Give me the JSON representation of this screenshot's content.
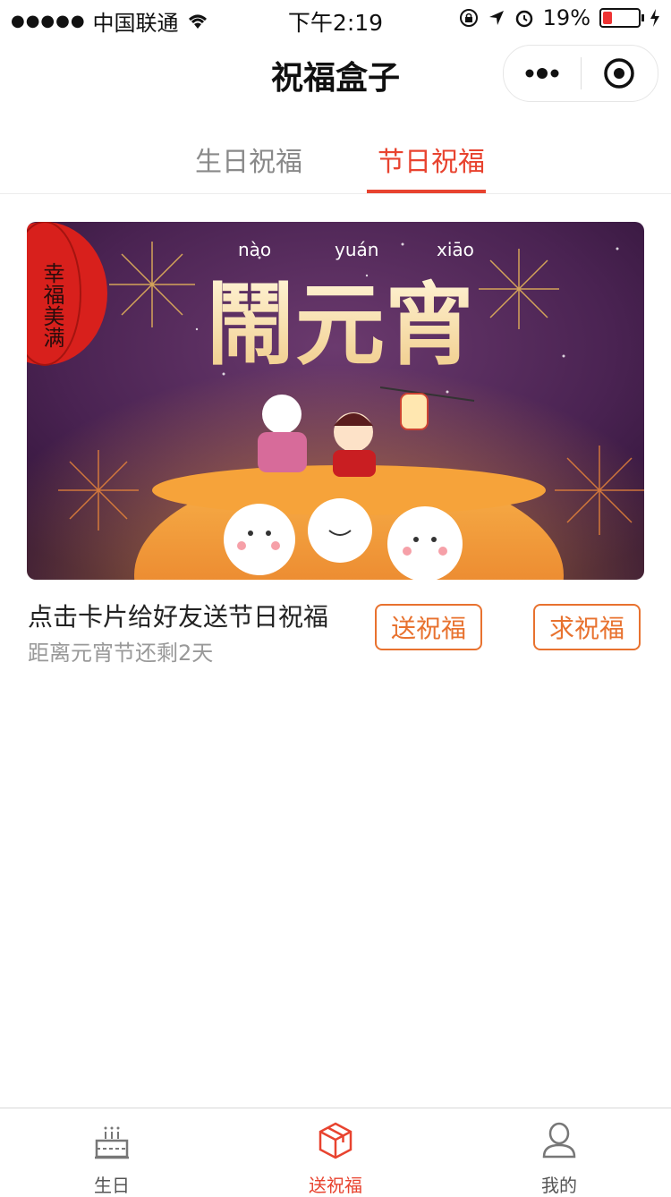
{
  "status_bar": {
    "carrier": "中国联通",
    "time": "下午2:19",
    "battery": "19%",
    "battery_level": 0.19
  },
  "navbar": {
    "title": "祝福盒子"
  },
  "tabs": [
    {
      "label": "生日祝福",
      "active": false
    },
    {
      "label": "节日祝福",
      "active": true
    }
  ],
  "card": {
    "banner_pinyin": [
      "nào",
      "yuán",
      "xiāo"
    ],
    "banner_title": "鬧元宵",
    "lantern_text": "幸福美满",
    "title": "点击卡片给好友送节日祝福",
    "subtitle": "距离元宵节还剩2天",
    "send_label": "送祝福",
    "ask_label": "求祝福"
  },
  "tabbar": [
    {
      "label": "生日",
      "icon": "cake-icon",
      "active": false
    },
    {
      "label": "送祝福",
      "icon": "gift-box-icon",
      "active": true
    },
    {
      "label": "我的",
      "icon": "user-icon",
      "active": false
    }
  ],
  "colors": {
    "accent": "#e8432f",
    "button": "#e8722f",
    "banner_bg": "#4a2352"
  }
}
